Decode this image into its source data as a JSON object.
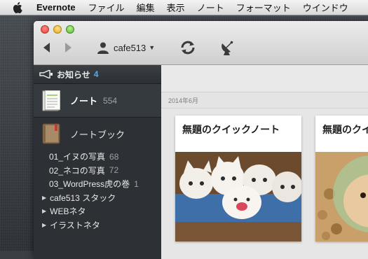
{
  "menubar": {
    "app": "Evernote",
    "items": [
      "ファイル",
      "編集",
      "表示",
      "ノート",
      "フォーマット",
      "ウインドウ"
    ]
  },
  "toolbar": {
    "account": "cafe513"
  },
  "sidebar": {
    "notifications_label": "お知らせ",
    "notifications_count": "4",
    "notes_label": "ノート",
    "notes_count": "554",
    "notebooks_label": "ノートブック",
    "notebooks": [
      {
        "name": "01_イヌの写真",
        "count": "68"
      },
      {
        "name": "02_ネコの写真",
        "count": "72"
      },
      {
        "name": "03_WordPress虎の巻",
        "count": "1"
      }
    ],
    "stacks": [
      "cafe513 スタック",
      "WEBネタ",
      "イラストネタ"
    ]
  },
  "main": {
    "date_header": "2014年6月",
    "cards": [
      {
        "title": "無題のクイックノート"
      },
      {
        "title": "無題のクイックノート"
      }
    ]
  },
  "colors": {
    "accent": "#5aa9e6",
    "sidebar_bg": "#2d3135"
  }
}
